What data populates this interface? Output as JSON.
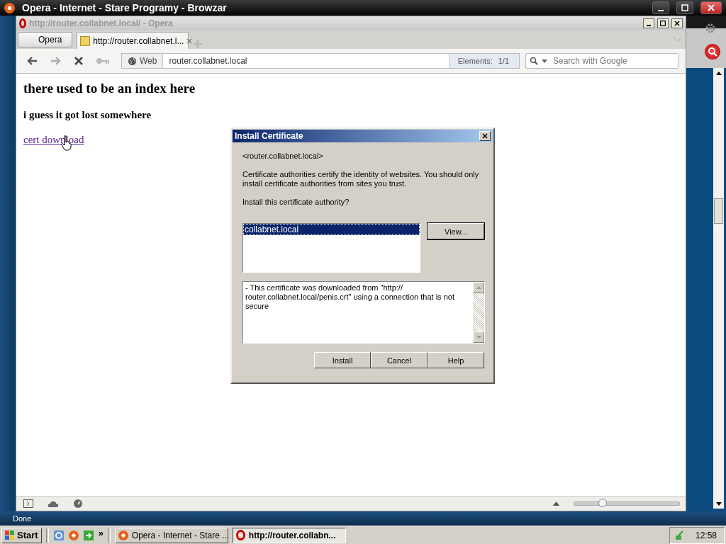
{
  "outer_window": {
    "title": "Opera - Internet - Stare Programy - Browzar"
  },
  "opera_window": {
    "title": "http://router.collabnet.local/ - Opera"
  },
  "opera_menu": {
    "label": "Opera"
  },
  "tabs": [
    {
      "label": "http://router.collabnet.l...",
      "selected": true
    }
  ],
  "address_bar": {
    "badge": "Web",
    "value": "router.collabnet.local",
    "elements_label": "Elements:",
    "elements_count": "1/1"
  },
  "search": {
    "placeholder": "Search with Google"
  },
  "page": {
    "heading": "there used to be an index here",
    "subheading": "i guess it got lost somewhere",
    "link": "cert download"
  },
  "zoom": {
    "level": 0.27
  },
  "status": "Done",
  "dialog": {
    "title": "Install Certificate",
    "host": "<router.collabnet.local>",
    "message": "Certificate authorities certify the identity of websites. You should only install certificate authorities from sites you trust.",
    "question": "Install this certificate authority?",
    "certificates": [
      {
        "label": "collabnet.local",
        "selected": true
      }
    ],
    "view_button": "View...",
    "details": "- This certificate was downloaded from \"http:// router.collabnet.local/penis.crt\" using a connection that is not secure",
    "buttons": [
      "Install",
      "Cancel",
      "Help"
    ]
  },
  "taskbar": {
    "start": "Start",
    "more": "»",
    "tasks": [
      {
        "label": "Opera - Internet - Stare ...",
        "selected": false,
        "kind": "browzar"
      },
      {
        "label": "http://router.collabn...",
        "selected": true,
        "kind": "opera"
      }
    ],
    "clock": "12:58"
  }
}
